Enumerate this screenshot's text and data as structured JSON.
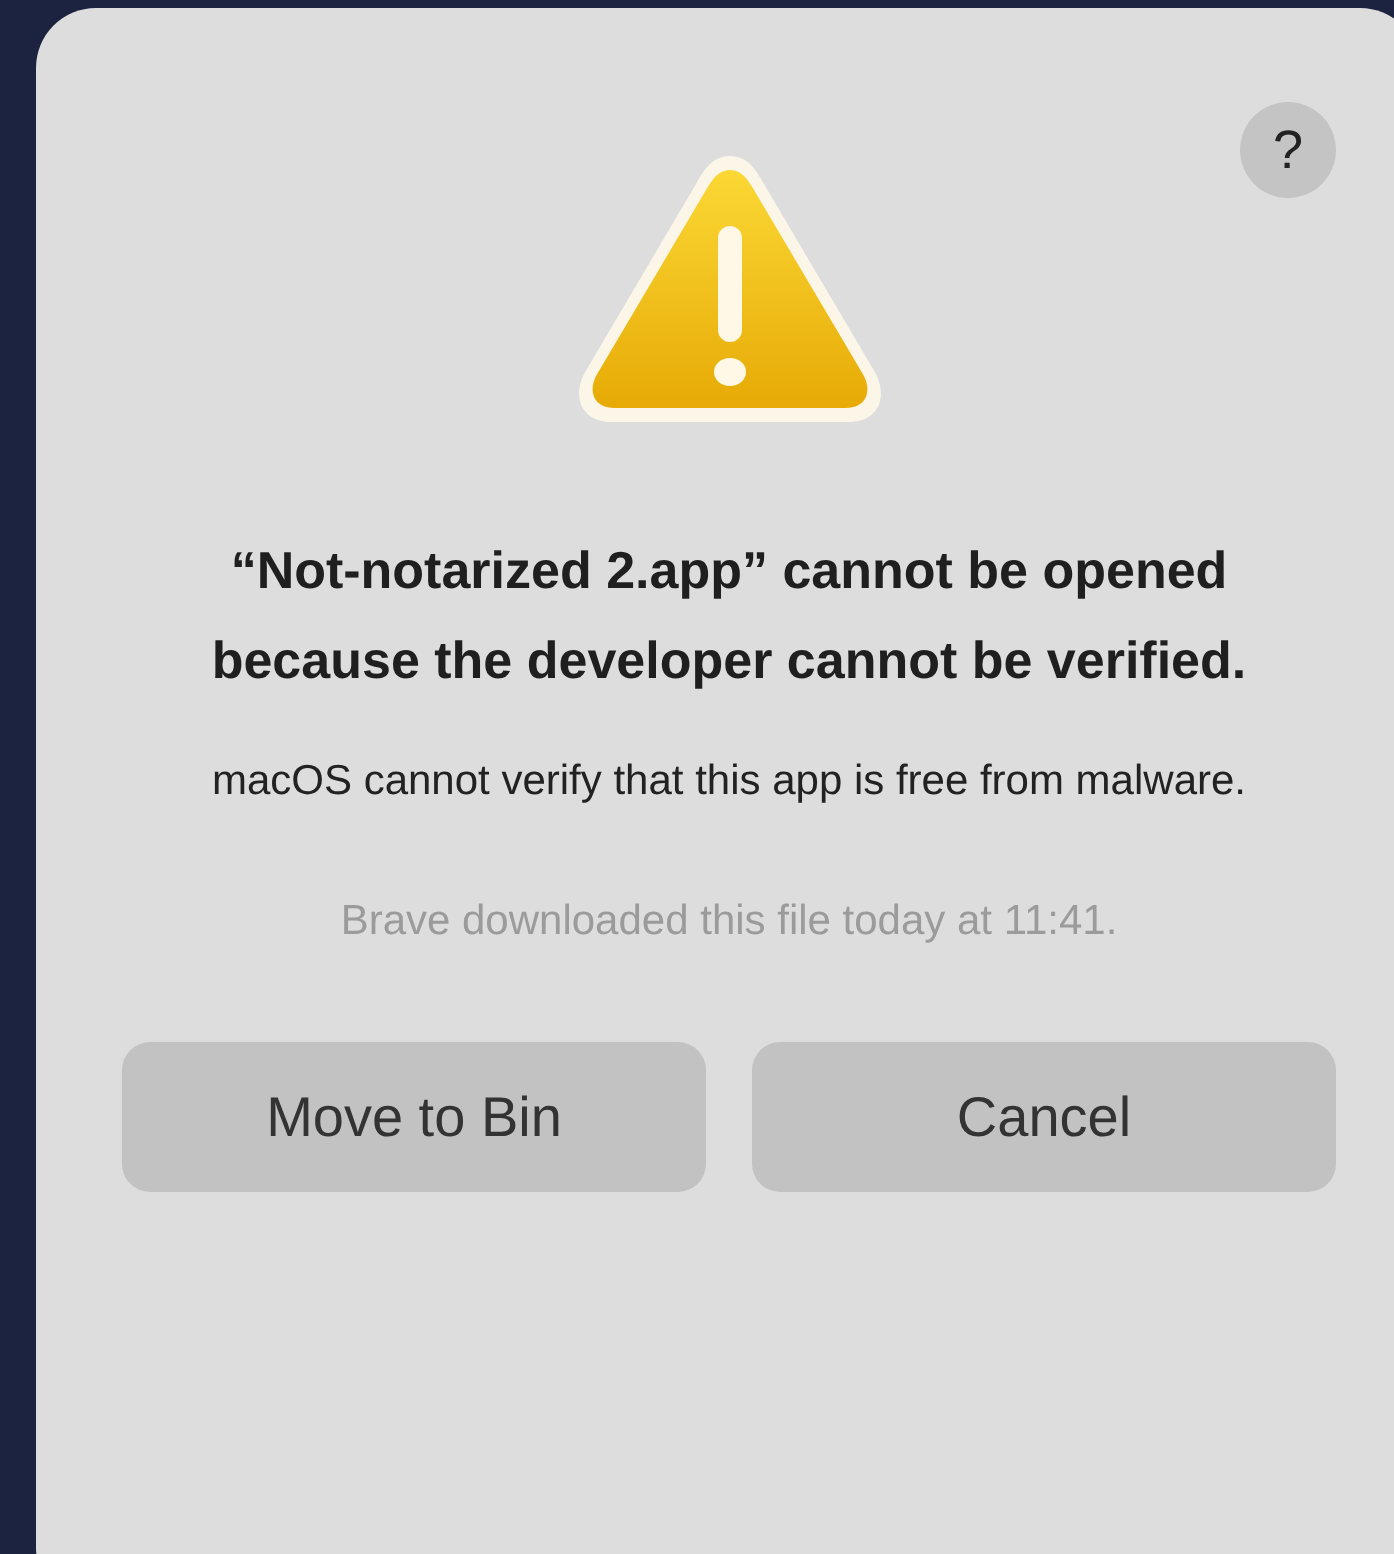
{
  "dialog": {
    "help_button": "?",
    "title": "“Not-notarized 2.app” cannot be opened because the developer cannot be verified.",
    "message": "macOS cannot verify that this app is free from malware.",
    "detail": "Brave downloaded this file today at 11:41.",
    "buttons": [
      {
        "label": "Move to Bin"
      },
      {
        "label": "Cancel"
      }
    ]
  }
}
